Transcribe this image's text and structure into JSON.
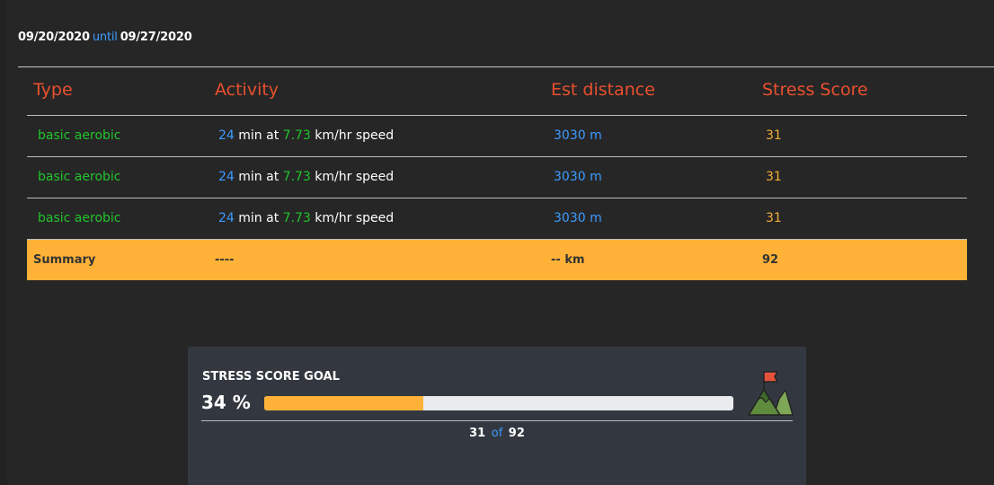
{
  "header": {
    "start_date": "09/20/2020",
    "until": "until",
    "end_date": "09/27/2020"
  },
  "table": {
    "columns": [
      "Type",
      "Activity",
      "Est distance",
      "Stress Score"
    ],
    "rows": [
      {
        "type": "basic aerobic",
        "minutes": "24",
        "min_at": "min at",
        "speed": "7.73",
        "speed_unit": "km/hr speed",
        "distance": "3030 m",
        "score": "31"
      },
      {
        "type": "basic aerobic",
        "minutes": "24",
        "min_at": "min at",
        "speed": "7.73",
        "speed_unit": "km/hr speed",
        "distance": "3030 m",
        "score": "31"
      },
      {
        "type": "basic aerobic",
        "minutes": "24",
        "min_at": "min at",
        "speed": "7.73",
        "speed_unit": "km/hr speed",
        "distance": "3030 m",
        "score": "31"
      }
    ],
    "summary": {
      "label": "Summary",
      "activity": "----",
      "distance": "-- km",
      "score": "92"
    }
  },
  "goal": {
    "title": "STRESS SCORE GOAL",
    "percent_label": "34 %",
    "progress_fraction": 0.34,
    "current": "31",
    "of": "of",
    "target": "92",
    "icon": "mountain-flag-icon"
  },
  "colors": {
    "header_text": "#e8502e",
    "type_green": "#22c42c",
    "accent_blue": "#3d9bff",
    "score_orange": "#f4ad37",
    "summary_bg": "#ffb237",
    "card_bg": "#333840"
  }
}
